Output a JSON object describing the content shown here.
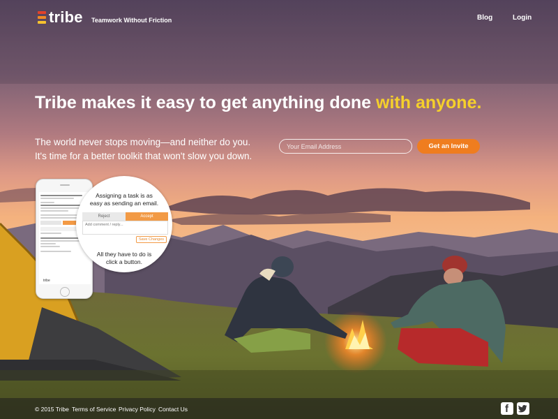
{
  "header": {
    "brand": "tribe",
    "tagline": "Teamwork Without Friction",
    "nav": [
      {
        "label": "Blog"
      },
      {
        "label": "Login"
      }
    ]
  },
  "hero": {
    "title_main": "Tribe makes it easy to get anything done ",
    "title_accent": "with anyone.",
    "subtitle_line1": "The world never stops moving—and neither do you.",
    "subtitle_line2": "It's time for a better toolkit that won't slow you down.",
    "email_placeholder": "Your Email Address",
    "cta_label": "Get an Invite"
  },
  "callout": {
    "title_line1": "Assigning a task is as",
    "title_line2": "easy as sending an email.",
    "reject_label": "Reject",
    "accept_label": "Accept",
    "comment_placeholder": "Add comment / reply...",
    "save_label": "Save Changes",
    "note_line1": "All they have to do is",
    "note_line2": "click a button."
  },
  "phone": {
    "footer_brand": "tribe"
  },
  "footer": {
    "copyright": "© 2015 Tribe",
    "links": [
      {
        "label": "Terms of Service"
      },
      {
        "label": "Privacy Policy"
      },
      {
        "label": "Contact Us"
      }
    ],
    "social": [
      {
        "icon": "facebook-icon"
      },
      {
        "icon": "twitter-icon"
      }
    ]
  },
  "colors": {
    "accent_yellow": "#f5d02b",
    "cta_orange": "#ef7d1f",
    "logo_red": "#e2412a",
    "logo_orange": "#f08a24",
    "logo_yellow": "#f6c22e"
  }
}
